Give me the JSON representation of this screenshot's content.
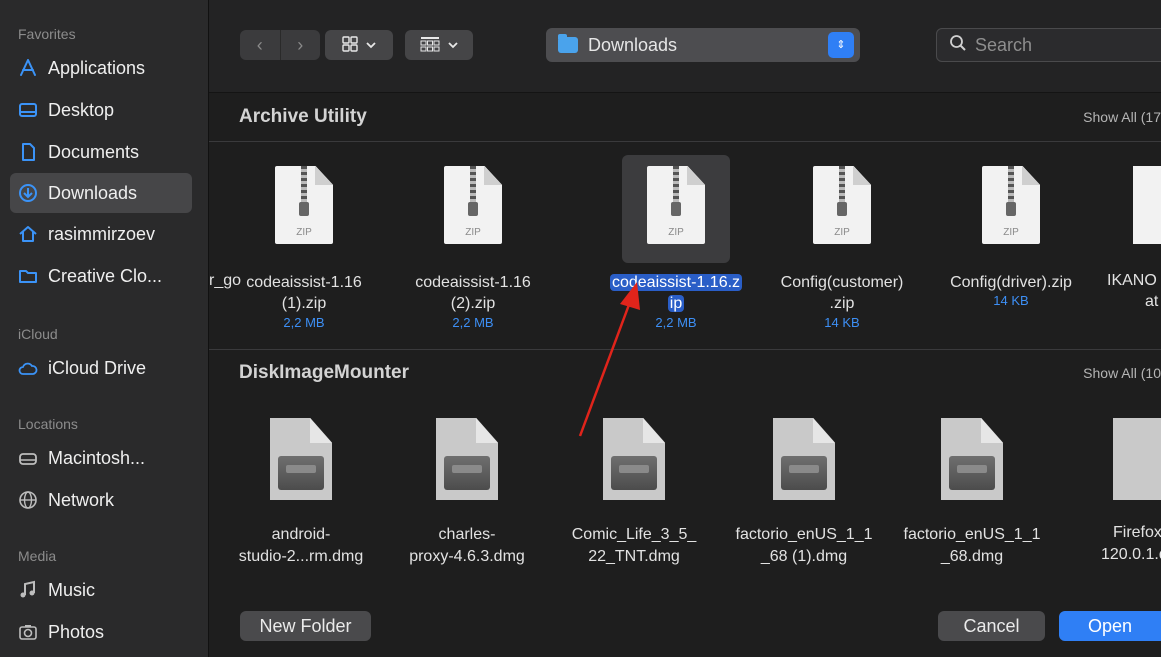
{
  "sidebar": {
    "favorites_title": "Favorites",
    "favorites": [
      {
        "label": "Applications",
        "icon": "applications-icon"
      },
      {
        "label": "Desktop",
        "icon": "desktop-icon"
      },
      {
        "label": "Documents",
        "icon": "document-icon"
      },
      {
        "label": "Downloads",
        "icon": "downloads-icon",
        "selected": true
      },
      {
        "label": "rasimmirzoev",
        "icon": "home-icon"
      },
      {
        "label": "Creative Clo...",
        "icon": "folder-icon"
      }
    ],
    "icloud_title": "iCloud",
    "icloud": [
      {
        "label": "iCloud Drive",
        "icon": "cloud-icon"
      }
    ],
    "locations_title": "Locations",
    "locations": [
      {
        "label": "Macintosh...",
        "icon": "disk-icon"
      },
      {
        "label": "Network",
        "icon": "globe-icon"
      }
    ],
    "media_title": "Media",
    "media": [
      {
        "label": "Music",
        "icon": "music-icon"
      },
      {
        "label": "Photos",
        "icon": "camera-icon"
      }
    ]
  },
  "toolbar": {
    "back": "‹",
    "forward": "›",
    "location": "Downloads",
    "search_placeholder": "Search"
  },
  "sections": [
    {
      "title": "Archive Utility",
      "show_all": "Show All (17",
      "partial_left": "r_go",
      "files": [
        {
          "name1": "codeaissist-1.16",
          "name2": "(1).zip",
          "size": "2,2 MB"
        },
        {
          "name1": "codeaissist-1.16",
          "name2": "(2).zip",
          "size": "2,2 MB"
        },
        {
          "name1": "codeaissist-1.16.z",
          "name2": "ip",
          "size": "2,2 MB",
          "selected": true
        },
        {
          "name1": "Config(customer)",
          "name2": ".zip",
          "size": "14 KB"
        },
        {
          "name1": "Config(driver).zip",
          "name2": "",
          "size": "14 KB"
        },
        {
          "name1": "IKANO",
          "name2": "at",
          "size": ""
        }
      ]
    },
    {
      "title": "DiskImageMounter",
      "show_all": "Show All (10",
      "files": [
        {
          "name1": "android-",
          "name2": "studio-2...rm.dmg"
        },
        {
          "name1": "charles-",
          "name2": "proxy-4.6.3.dmg"
        },
        {
          "name1": "Comic_Life_3_5_",
          "name2": "22_TNT.dmg"
        },
        {
          "name1": "factorio_enUS_1_1",
          "name2": "_68 (1).dmg"
        },
        {
          "name1": "factorio_enUS_1_1",
          "name2": "_68.dmg"
        },
        {
          "name1": "Firefox",
          "name2": "120.0.1.d"
        }
      ]
    }
  ],
  "buttons": {
    "new_folder": "New Folder",
    "cancel": "Cancel",
    "open": "Open"
  },
  "colors": {
    "accent": "#2f7ff5",
    "selection": "#2a5ec7",
    "annotation": "#e0241b"
  }
}
